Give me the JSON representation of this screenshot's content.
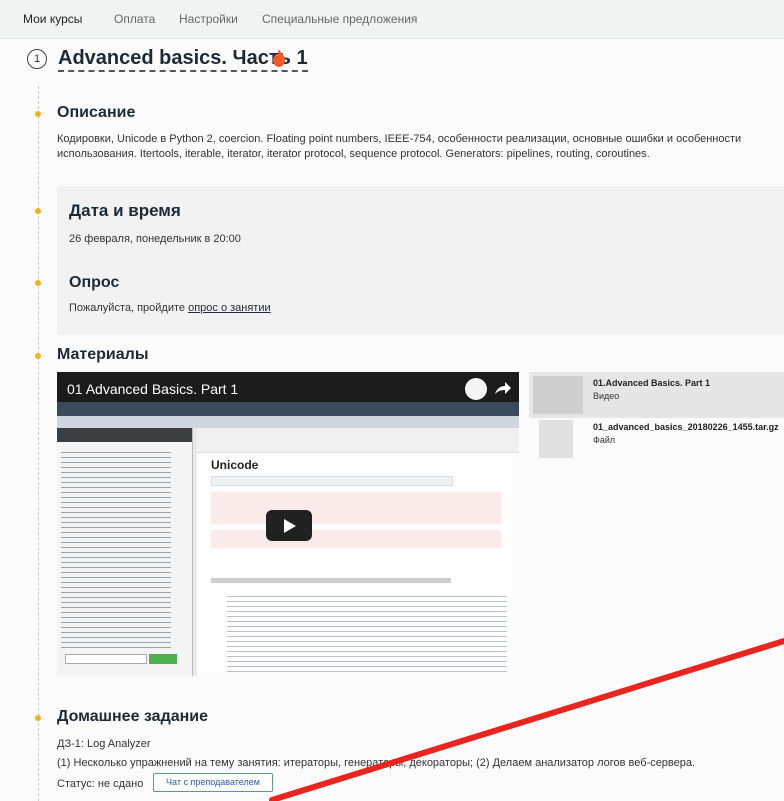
{
  "nav": {
    "tabs": [
      {
        "label": "Мои курсы",
        "active": true
      },
      {
        "label": "Оплата",
        "active": false
      },
      {
        "label": "Настройки",
        "active": false
      },
      {
        "label": "Специальные предложения",
        "active": false
      }
    ]
  },
  "lesson": {
    "number": "1",
    "title": "Advanced basics. Часть 1"
  },
  "sections": {
    "description": {
      "title": "Описание",
      "text": "Кодировки, Unicode в Python 2, coercion. Floating point numbers, IEEE-754, особенности реализации, основные ошибки и особенности использования. Itertools, iterable, iterator, iterator protocol, sequence protocol. Generators: pipelines, routing, coroutines."
    },
    "datetime": {
      "title": "Дата и время",
      "text": "26 февраля, понедельник в 20:00"
    },
    "survey": {
      "title": "Опрос",
      "text_before": "Пожалуйста, пройдите ",
      "link": "опрос о занятии"
    },
    "materials": {
      "title": "Материалы",
      "video_title": "01 Advanced Basics. Part 1",
      "video_screen_heading": "Unicode",
      "items": [
        {
          "name": "01.Advanced Basics. Part 1",
          "type": "Видео"
        },
        {
          "name": "01_advanced_basics_20180226_1455.tar.gz",
          "type": "Файл"
        }
      ]
    },
    "homework": {
      "title": "Домашнее задание",
      "subtitle": "ДЗ-1: Log Analyzer",
      "text": "(1) Несколько упражнений на тему занятия: итераторы, генераторы, декораторы; (2) Делаем анализатор логов веб-сервера.",
      "status_label": "Статус: не сдано",
      "chat_button": "Чат с преподавателем"
    }
  },
  "colors": {
    "accent_dot": "#f2b320",
    "flame": "#f15a24",
    "annotation": "#e8261f",
    "button_border": "#5b8ec7"
  }
}
